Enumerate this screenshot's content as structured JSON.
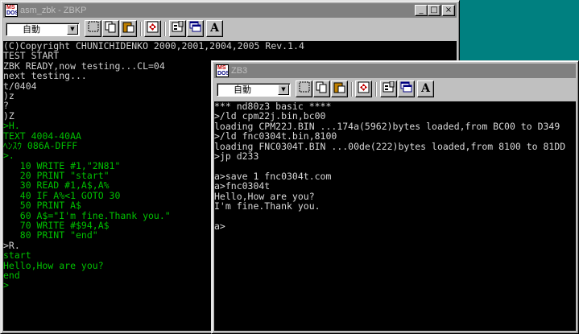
{
  "window1": {
    "title": "asm_zbk - ZBKP",
    "font_mode": "自動",
    "text_color": "#cfcfcf",
    "lines": [
      {
        "t": "(C)Copyright CHUNICHIDENKO 2000,2001,2004,2005 Rev.1.4",
        "c": "#cfcfcf"
      },
      {
        "t": "TEST START",
        "c": "#cfcfcf"
      },
      {
        "t": "ZBK READY,now testing...CL=04",
        "c": "#cfcfcf"
      },
      {
        "t": "next testing...",
        "c": "#cfcfcf"
      },
      {
        "t": "t/0404",
        "c": "#cfcfcf"
      },
      {
        "t": ")z",
        "c": "#cfcfcf"
      },
      {
        "t": "?",
        "c": "#cfcfcf"
      },
      {
        "t": ")Z",
        "c": "#cfcfcf"
      },
      {
        "t": ">H.",
        "c": "#00c000"
      },
      {
        "t": "TEXT 4004-40AA",
        "c": "#00c000"
      },
      {
        "t": "ﾍﾝｽｳ 086A-DFFF",
        "c": "#00c000"
      },
      {
        "t": ">.",
        "c": "#00c000"
      },
      {
        "t": "   10 WRITE #1,\"2N81\"",
        "c": "#00c000"
      },
      {
        "t": "   20 PRINT \"start\"",
        "c": "#00c000"
      },
      {
        "t": "   30 READ #1,A$,A%",
        "c": "#00c000"
      },
      {
        "t": "   40 IF A%<1 GOTO 30",
        "c": "#00c000"
      },
      {
        "t": "   50 PRINT A$",
        "c": "#00c000"
      },
      {
        "t": "   60 A$=\"I'm fine.Thank you.\"",
        "c": "#00c000"
      },
      {
        "t": "   70 WRITE #$94,A$",
        "c": "#00c000"
      },
      {
        "t": "   80 PRINT \"end\"",
        "c": "#00c000"
      },
      {
        "t": ">R.",
        "c": "#cfcfcf"
      },
      {
        "t": "start",
        "c": "#00c000"
      },
      {
        "t": "Hello,How are you?",
        "c": "#00c000"
      },
      {
        "t": "end",
        "c": "#00c000"
      },
      {
        "t": ">",
        "c": "#00c000"
      }
    ]
  },
  "window2": {
    "title": "ZB3",
    "font_mode": "自動",
    "text_color": "#d8d8d8",
    "lines": [
      "*** nd80z3 basic ****",
      ">/ld cpm22j.bin,bc00",
      "loading CPM22J.BIN ...174a(5962)bytes loaded,from BC00 to D349",
      ">/ld fnc0304t.bin,8100",
      "loading FNC0304T.BIN ...00de(222)bytes loaded,from 8100 to 81DD",
      ">jp d233",
      "",
      "a>save 1 fnc0304t.com",
      "a>fnc0304t",
      "Hello,How are you?",
      "I'm fine.Thank you.",
      "",
      "a>"
    ]
  },
  "controls": {
    "minimize": "_",
    "maximize": "□",
    "close": "×",
    "dropdown_arrow": "▼",
    "font_button": "A"
  }
}
